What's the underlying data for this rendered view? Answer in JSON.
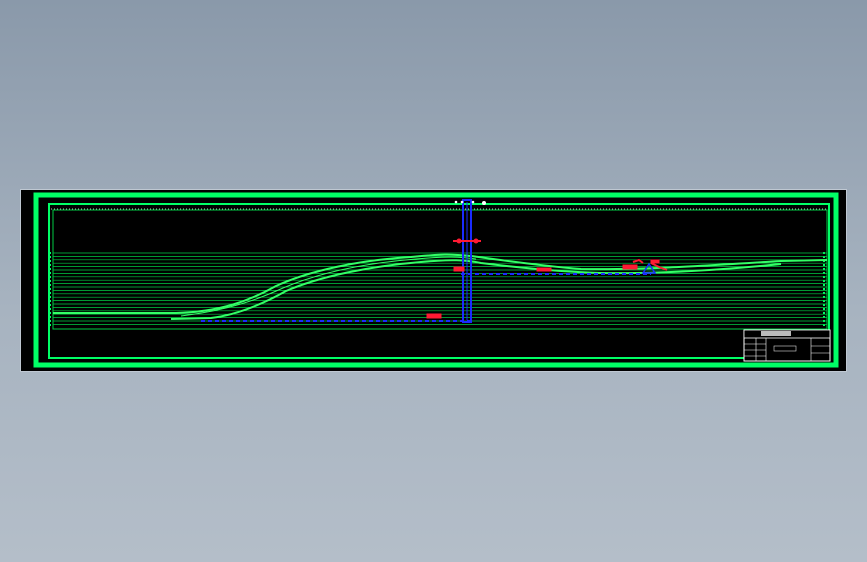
{
  "app": {
    "background_color": "#9aa8b7",
    "canvas_color": "#000000"
  },
  "drawing": {
    "colors": {
      "frame": "#00ff66",
      "profile_lines": "#33ff66",
      "guide_lines": "#00cc44",
      "structure": "#1a2bff",
      "annotation": "#ff1a33",
      "title_block": "#ffffff"
    },
    "icons": {
      "section_markers": "circle-marker-icon",
      "elevation_marker": "triangle-marker-icon"
    }
  }
}
